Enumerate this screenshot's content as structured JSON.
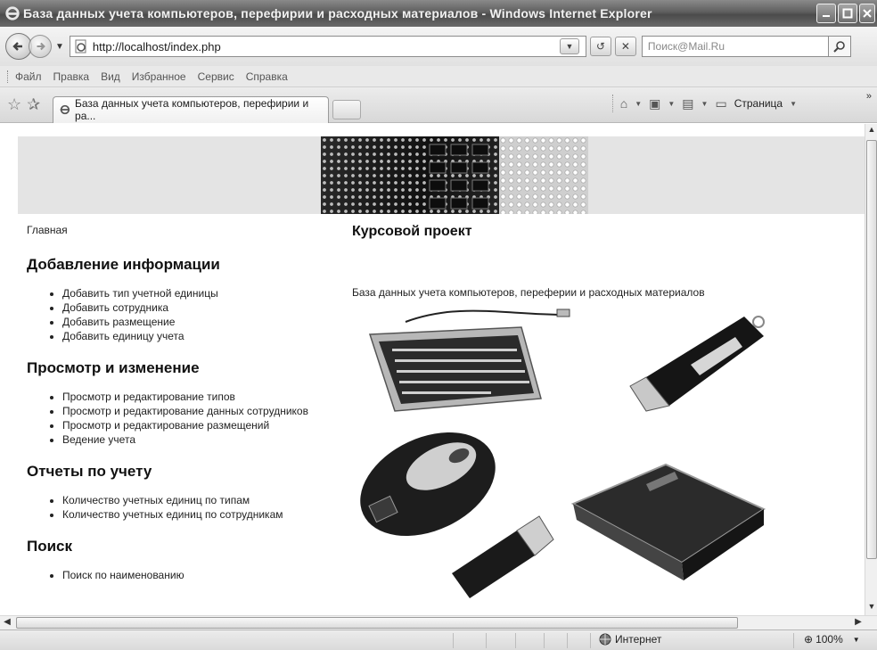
{
  "window": {
    "title": "База данных учета компьютеров, перефирии и расходных материалов - Windows Internet Explorer"
  },
  "address": {
    "url": "http://localhost/index.php",
    "search_placeholder": "Поиск@Mail.Ru"
  },
  "menu": [
    "Файл",
    "Правка",
    "Вид",
    "Избранное",
    "Сервис",
    "Справка"
  ],
  "tab": {
    "label": "База данных учета компьютеров, перефирии и ра..."
  },
  "commands": {
    "page_label": "Страница"
  },
  "page": {
    "home_link": "Главная",
    "sections": [
      {
        "title": "Добавление информации",
        "items": [
          "Добавить тип учетной единицы",
          "Добавить сотрудника",
          "Добавить размещение",
          "Добавить единицу учета"
        ]
      },
      {
        "title": "Просмотр и изменение",
        "items": [
          "Просмотр и редактирование типов",
          "Просмотр и редактирование данных сотрудников",
          "Просмотр и редактирование размещений",
          "Ведение учета"
        ]
      },
      {
        "title": "Отчеты по учету",
        "items": [
          "Количество учетных единиц по типам",
          "Количество учетных единиц по сотрудникам"
        ]
      },
      {
        "title": "Поиск",
        "items": [
          "Поиск по наименованию"
        ]
      }
    ],
    "main_title": "Курсовой проект",
    "main_desc": "База данных учета компьютеров, переферии и расходных материалов"
  },
  "status": {
    "zone": "Интернет",
    "zoom": "100%"
  },
  "icons": {
    "back": "back-arrow-icon",
    "forward": "forward-arrow-icon",
    "refresh": "refresh-icon",
    "stop": "stop-icon",
    "search": "magnifier-icon",
    "home": "home-icon",
    "feeds": "feeds-icon",
    "print": "printer-icon",
    "page": "page-icon",
    "globe": "globe-icon"
  }
}
